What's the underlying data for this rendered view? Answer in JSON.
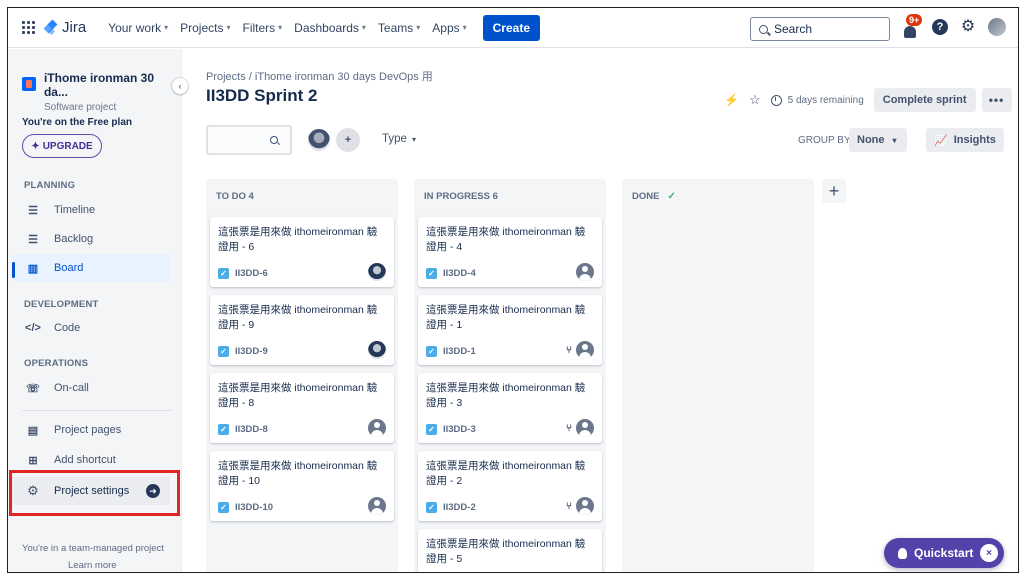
{
  "topnav": {
    "app_name": "Jira",
    "items": [
      {
        "label": "Your work"
      },
      {
        "label": "Projects"
      },
      {
        "label": "Filters"
      },
      {
        "label": "Dashboards"
      },
      {
        "label": "Teams"
      },
      {
        "label": "Apps"
      }
    ],
    "create_label": "Create",
    "search_placeholder": "Search",
    "notifications_badge": "9+"
  },
  "sidebar": {
    "project_name": "iThome ironman 30 da...",
    "project_type": "Software project",
    "plan_text": "You're on the Free plan",
    "upgrade_label": "UPGRADE",
    "sections": {
      "planning": "PLANNING",
      "development": "DEVELOPMENT",
      "operations": "OPERATIONS"
    },
    "items": {
      "timeline": "Timeline",
      "backlog": "Backlog",
      "board": "Board",
      "code": "Code",
      "oncall": "On-call",
      "project_pages": "Project pages",
      "add_shortcut": "Add shortcut",
      "project_settings": "Project settings"
    },
    "footer_text": "You're in a team-managed project",
    "learn_more": "Learn more"
  },
  "main": {
    "breadcrumb": "Projects  /  iThome ironman 30 days DevOps 用",
    "title": "II3DD Sprint 2",
    "days_remaining": "5 days remaining",
    "complete_sprint": "Complete sprint",
    "more_label": "•••",
    "type_filter": "Type",
    "group_by_label": "GROUP BY",
    "group_by_value": "None",
    "insights_label": "Insights"
  },
  "columns": [
    {
      "title": "TO DO 4",
      "cards": [
        {
          "title": "這張票是用來做 ithomeironman 驗證用 - 6",
          "key": "II3DD-6",
          "assignee": "photo"
        },
        {
          "title": "這張票是用來做 ithomeironman 驗證用 - 9",
          "key": "II3DD-9",
          "assignee": "photo"
        },
        {
          "title": "這張票是用來做 ithomeironman 驗證用 - 8",
          "key": "II3DD-8",
          "assignee": "unassigned"
        },
        {
          "title": "這張票是用來做 ithomeironman 驗證用 - 10",
          "key": "II3DD-10",
          "assignee": "unassigned"
        }
      ]
    },
    {
      "title": "IN PROGRESS 6",
      "cards": [
        {
          "title": "這張票是用來做 ithomeironman 驗證用 - 4",
          "key": "II3DD-4",
          "assignee": "unassigned"
        },
        {
          "title": "這張票是用來做 ithomeironman 驗證用 - 1",
          "key": "II3DD-1",
          "assignee": "unassigned",
          "branch": true
        },
        {
          "title": "這張票是用來做 ithomeironman 驗證用 - 3",
          "key": "II3DD-3",
          "assignee": "unassigned",
          "branch": true
        },
        {
          "title": "這張票是用來做 ithomeironman 驗證用 - 2",
          "key": "II3DD-2",
          "assignee": "unassigned",
          "branch": true
        },
        {
          "title": "這張票是用來做 ithomeironman 驗證用 - 5",
          "key": "",
          "assignee": "none"
        }
      ]
    },
    {
      "title": "DONE",
      "cards": []
    }
  ],
  "quickstart": {
    "label": "Quickstart",
    "close": "×"
  },
  "colors": {
    "primary": "#0052cc",
    "upgrade": "#5e4db2",
    "quickstart": "#5243aa",
    "highlight": "#e32424",
    "done_check": "#36b37e",
    "task_icon": "#4bade8"
  }
}
